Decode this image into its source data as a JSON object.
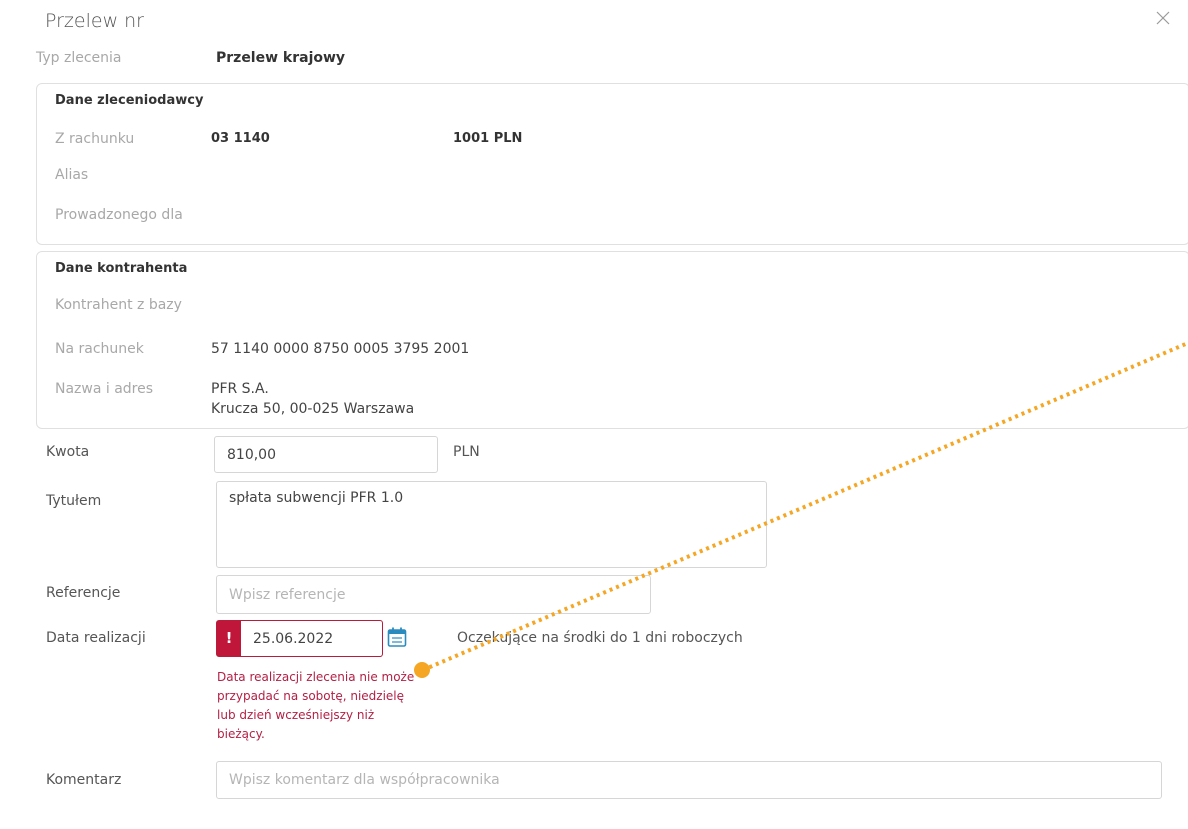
{
  "dialog": {
    "title": "Przelew nr",
    "order_type_label": "Typ zlecenia",
    "order_type_value": "Przelew krajowy"
  },
  "sender": {
    "section_title": "Dane zleceniodawcy",
    "from_account_label": "Z rachunku",
    "from_account_prefix": "03 1140",
    "from_account_suffix": "1001 PLN",
    "alias_label": "Alias",
    "owner_label": "Prowadzonego dla"
  },
  "counterparty": {
    "section_title": "Dane kontrahenta",
    "from_base_label": "Kontrahent z bazy",
    "account_label": "Na rachunek",
    "account_value": "57 1140 0000 8750 0005 3795 2001",
    "name_label": "Nazwa i adres",
    "name_line1": "PFR S.A.",
    "name_line2": "Krucza 50, 00-025 Warszawa"
  },
  "form": {
    "amount_label": "Kwota",
    "amount_value": "810,00",
    "currency": "PLN",
    "title_label": "Tytułem",
    "title_value": "spłata subwencji PFR 1.0",
    "reference_label": "Referencje",
    "reference_placeholder": "Wpisz referencje",
    "date_label": "Data realizacji",
    "date_alert_symbol": "!",
    "date_value": "25.06.2022",
    "date_info": "Oczekujące na środki do 1 dni roboczych",
    "date_error": "Data realizacji zlecenia nie może przypadać na sobotę, niedzielę lub dzień wcześniejszy niż bieżący.",
    "comment_label": "Komentarz",
    "comment_placeholder": "Wpisz komentarz dla współpracownika"
  },
  "colors": {
    "error": "#b32045",
    "alert_bg": "#c0163a",
    "annotation": "#f5a623",
    "calendar_icon": "#2a8bbf"
  },
  "icons": {
    "close": "close-icon",
    "calendar": "calendar-icon"
  }
}
